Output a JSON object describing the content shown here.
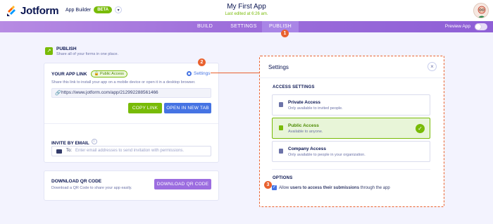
{
  "brand": {
    "name": "Jotform"
  },
  "header": {
    "app_builder_label": "App Builder",
    "beta_badge": "BETA",
    "app_title": "My First App",
    "last_edited": "Last edited at 6:26 am."
  },
  "nav": {
    "tabs": [
      {
        "label": "BUILD"
      },
      {
        "label": "SETTINGS"
      },
      {
        "label": "PUBLISH"
      }
    ],
    "preview_label": "Preview App",
    "preview_enabled": false
  },
  "publish": {
    "title": "PUBLISH",
    "subtitle": "Share all of your forms in one place."
  },
  "app_link": {
    "title": "YOUR APP LINK",
    "access_badge": "Public Access",
    "settings_label": "Settings",
    "description": "Share this link to install your app on a mobile device or open it in a desktop browser.",
    "url": "https://www.jotform.com/app/212992288561466",
    "copy_button": "COPY LINK",
    "open_button": "OPEN IN NEW TAB"
  },
  "invite": {
    "title": "INVITE BY EMAIL",
    "to_label": "To:",
    "placeholder": "Enter email addresses to send invitation with permissions."
  },
  "qr": {
    "title": "DOWNLOAD QR CODE",
    "description": "Download a QR Code to share your app easily.",
    "button": "DOWNLOAD QR CODE"
  },
  "settings_panel": {
    "title": "Settings",
    "access_section": "ACCESS SETTINGS",
    "options": [
      {
        "title": "Private Access",
        "desc": "Only available to invited people.",
        "selected": false
      },
      {
        "title": "Public Access",
        "desc": "Available to anyone.",
        "selected": true
      },
      {
        "title": "Company Access",
        "desc": "Only available to people in your organization.",
        "selected": false
      }
    ],
    "options_section": "OPTIONS",
    "allow_prefix": "Allow ",
    "allow_bold": "users to access their submissions",
    "allow_suffix": " through the app",
    "allow_checked": true
  },
  "markers": {
    "step1": "1",
    "step2": "2",
    "step3": "3"
  },
  "colors": {
    "accent_green": "#78bb07",
    "accent_blue": "#4573e3",
    "nav_purple": "#9e6fdb",
    "annotation_orange": "#e9612e"
  }
}
